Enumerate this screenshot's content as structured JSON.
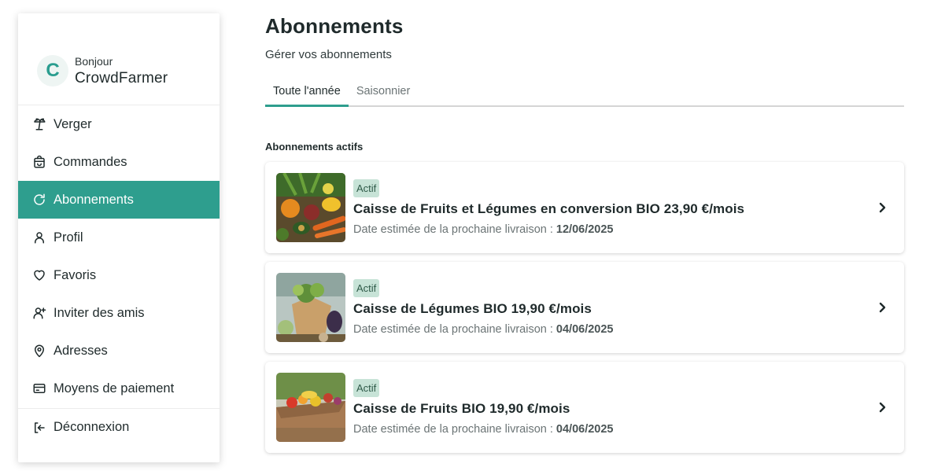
{
  "user": {
    "avatar_letter": "C",
    "greeting": "Bonjour",
    "name": "CrowdFarmer"
  },
  "sidebar": {
    "items": [
      {
        "label": "Verger",
        "icon": "palm-tree-icon",
        "active": false
      },
      {
        "label": "Commandes",
        "icon": "bag-icon",
        "active": false
      },
      {
        "label": "Abonnements",
        "icon": "refresh-icon",
        "active": true
      },
      {
        "label": "Profil",
        "icon": "user-icon",
        "active": false
      },
      {
        "label": "Favoris",
        "icon": "heart-icon",
        "active": false
      },
      {
        "label": "Inviter des amis",
        "icon": "user-plus-icon",
        "active": false
      },
      {
        "label": "Adresses",
        "icon": "map-pin-icon",
        "active": false
      },
      {
        "label": "Moyens de paiement",
        "icon": "credit-card-icon",
        "active": false
      }
    ],
    "logout_label": "Déconnexion"
  },
  "page": {
    "title": "Abonnements",
    "subtitle": "Gérer vos abonnements"
  },
  "tabs": [
    {
      "label": "Toute l'année",
      "active": true
    },
    {
      "label": "Saisonnier",
      "active": false
    }
  ],
  "section_label": "Abonnements actifs",
  "subscriptions": [
    {
      "badge": "Actif",
      "title": "Caisse de Fruits et Légumes en conversion BIO 23,90 €/mois",
      "date_label": "Date estimée de la prochaine livraison : ",
      "date": "12/06/2025"
    },
    {
      "badge": "Actif",
      "title": "Caisse de Légumes BIO 19,90 €/mois",
      "date_label": "Date estimée de la prochaine livraison : ",
      "date": "04/06/2025"
    },
    {
      "badge": "Actif",
      "title": "Caisse de Fruits BIO 19,90 €/mois",
      "date_label": "Date estimée de la prochaine livraison : ",
      "date": "04/06/2025"
    }
  ],
  "colors": {
    "accent": "#2e9e8e",
    "badge_bg": "#c7e3d7",
    "text": "#1f2a2b",
    "muted": "#6b7475"
  }
}
